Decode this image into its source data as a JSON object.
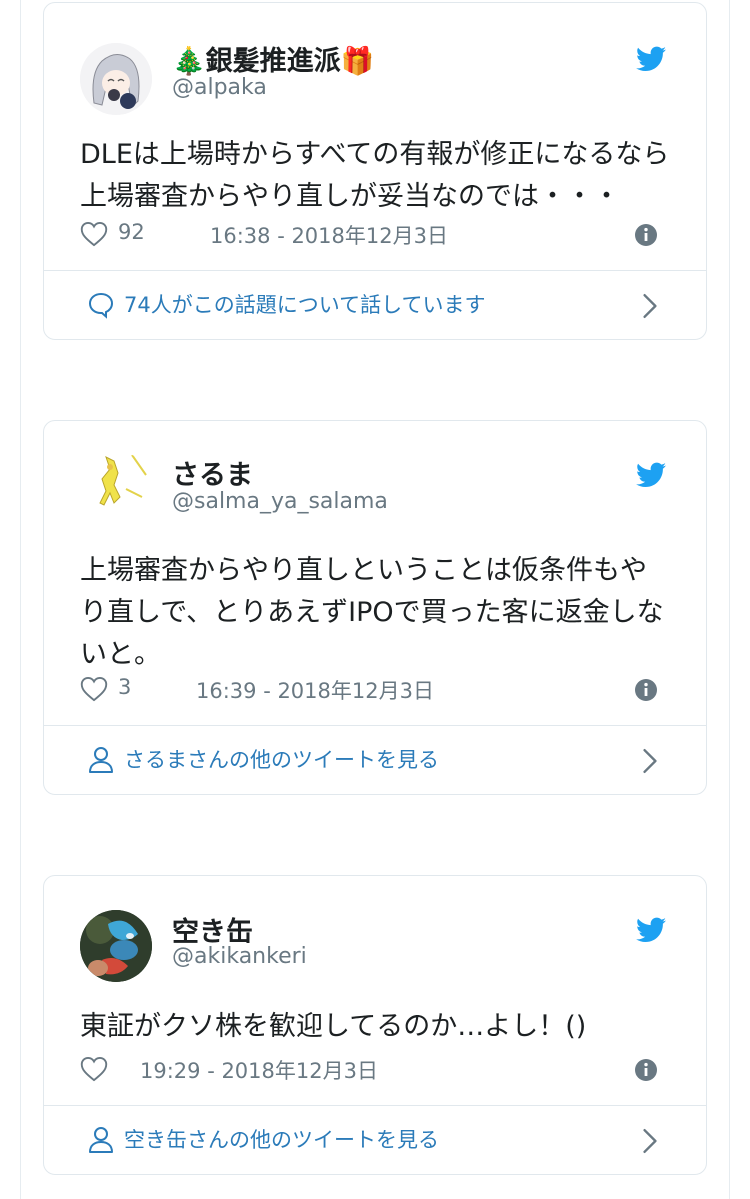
{
  "tweets": [
    {
      "name": "🎄銀髪推進派🎁",
      "handle": "@alpaka",
      "text": "DLEは上場時からすべての有報が修正になるなら上場審査からやり直しが妥当なのでは・・・",
      "likes": "92",
      "timestamp": "16:38 - 2018年12月3日",
      "footer": "74人がこの話題について話しています",
      "footer_icon": "speech-bubble-icon"
    },
    {
      "name": "さるま",
      "handle": "@salma_ya_salama",
      "text": "上場審査からやり直しということは仮条件もやり直しで、とりあえずIPOで買った客に返金しないと。",
      "likes": "3",
      "timestamp": "16:39 - 2018年12月3日",
      "footer": "さるまさんの他のツイートを見る",
      "footer_icon": "person-icon"
    },
    {
      "name": "空き缶",
      "handle": "@akikankeri",
      "text": "東証がクソ株を歓迎してるのか…よし！()",
      "likes": "",
      "timestamp": "19:29 - 2018年12月3日",
      "footer": "空き缶さんの他のツイートを見る",
      "footer_icon": "person-icon"
    }
  ],
  "colors": {
    "accent": "#1da1f2",
    "link": "#2b7bb9",
    "muted": "#697882",
    "border": "#e1e8ed"
  }
}
